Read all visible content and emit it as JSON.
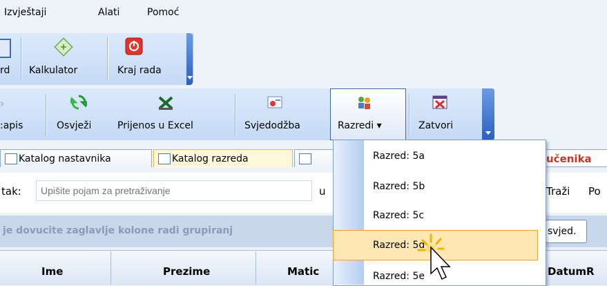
{
  "menubar": {
    "items": [
      "Izvještaji",
      "Alati",
      "Pomoć"
    ]
  },
  "toolbar1": {
    "items": [
      {
        "label": "rd",
        "icon": "card-icon"
      },
      {
        "label": "Kalkulator",
        "icon": "calculator-icon"
      },
      {
        "label": "Kraj rada",
        "icon": "power-icon"
      }
    ]
  },
  "toolbar2": {
    "items": [
      {
        "label": ":apis",
        "icon": "record-icon"
      },
      {
        "label": "Osvježi",
        "icon": "refresh-icon"
      },
      {
        "label": "Prijenos u Excel",
        "icon": "excel-icon"
      },
      {
        "label": "Svjedodžba",
        "icon": "certificate-icon"
      },
      {
        "label": "Razredi ▾",
        "icon": "classes-icon"
      },
      {
        "label": "Zatvori",
        "icon": "close-window-icon"
      }
    ]
  },
  "tabs": {
    "t1": "Katalog nastavnika",
    "t2": "Katalog razreda",
    "t3": "",
    "t4": "učenika"
  },
  "search": {
    "label": "tak:",
    "placeholder": "Upišite pojam za pretraživanje",
    "u_label": "u",
    "find": "Traži",
    "find2": "Po"
  },
  "group": {
    "hint": "je dovucite zaglavlje kolone radi grupiranj",
    "button": "svjed."
  },
  "grid": {
    "columns": [
      "Ime",
      "Prezime",
      "Matic",
      "DatumR"
    ]
  },
  "dropdown": {
    "items": [
      "Razred: 5a",
      "Razred: 5b",
      "Razred: 5c",
      "Razred: 5d",
      "Razred: 5e"
    ],
    "selected_index": 3
  }
}
